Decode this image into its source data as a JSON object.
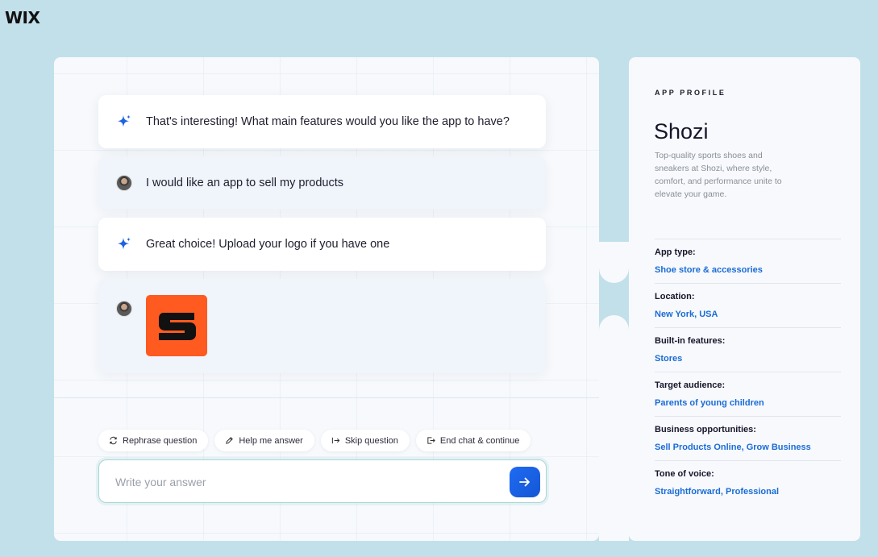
{
  "brand": {
    "logo_text": "WIX"
  },
  "chat": {
    "messages": [
      {
        "role": "assistant",
        "icon": "sparkle-icon",
        "text": "That's interesting! What main features would you like the app to have?"
      },
      {
        "role": "user",
        "icon": "avatar",
        "text": "I would like an app to sell my products"
      },
      {
        "role": "assistant",
        "icon": "sparkle-icon",
        "text": "Great choice!  Upload your logo if you have one"
      },
      {
        "role": "user",
        "icon": "avatar",
        "attachment": "uploaded-logo-image"
      }
    ],
    "actions": [
      {
        "label": "Rephrase question",
        "icon": "refresh-icon"
      },
      {
        "label": "Help me answer",
        "icon": "pencil-icon"
      },
      {
        "label": "Skip question",
        "icon": "skip-icon"
      },
      {
        "label": "End chat & continue",
        "icon": "exit-icon"
      }
    ],
    "input": {
      "placeholder": "Write your answer",
      "value": ""
    },
    "send_icon": "arrow-right-icon"
  },
  "profile": {
    "section_label": "APP PROFILE",
    "name": "Shozi",
    "description": "Top-quality sports shoes and sneakers at Shozi, where style, comfort, and performance unite to elevate your game.",
    "fields": [
      {
        "label": "App type:",
        "value": "Shoe store & accessories"
      },
      {
        "label": "Location:",
        "value": "New York, USA"
      },
      {
        "label": "Built-in features:",
        "value": "Stores"
      },
      {
        "label": "Target audience:",
        "value": "Parents of young children"
      },
      {
        "label": "Business opportunities:",
        "value": "Sell Products Online, Grow Business"
      },
      {
        "label": "Tone of voice:",
        "value": "Straightforward, Professional"
      }
    ]
  },
  "colors": {
    "background": "#c2e0ea",
    "accent": "#1a6cd6",
    "send_button": "#1e6bf2",
    "logo_orange": "#ff5a1f"
  }
}
